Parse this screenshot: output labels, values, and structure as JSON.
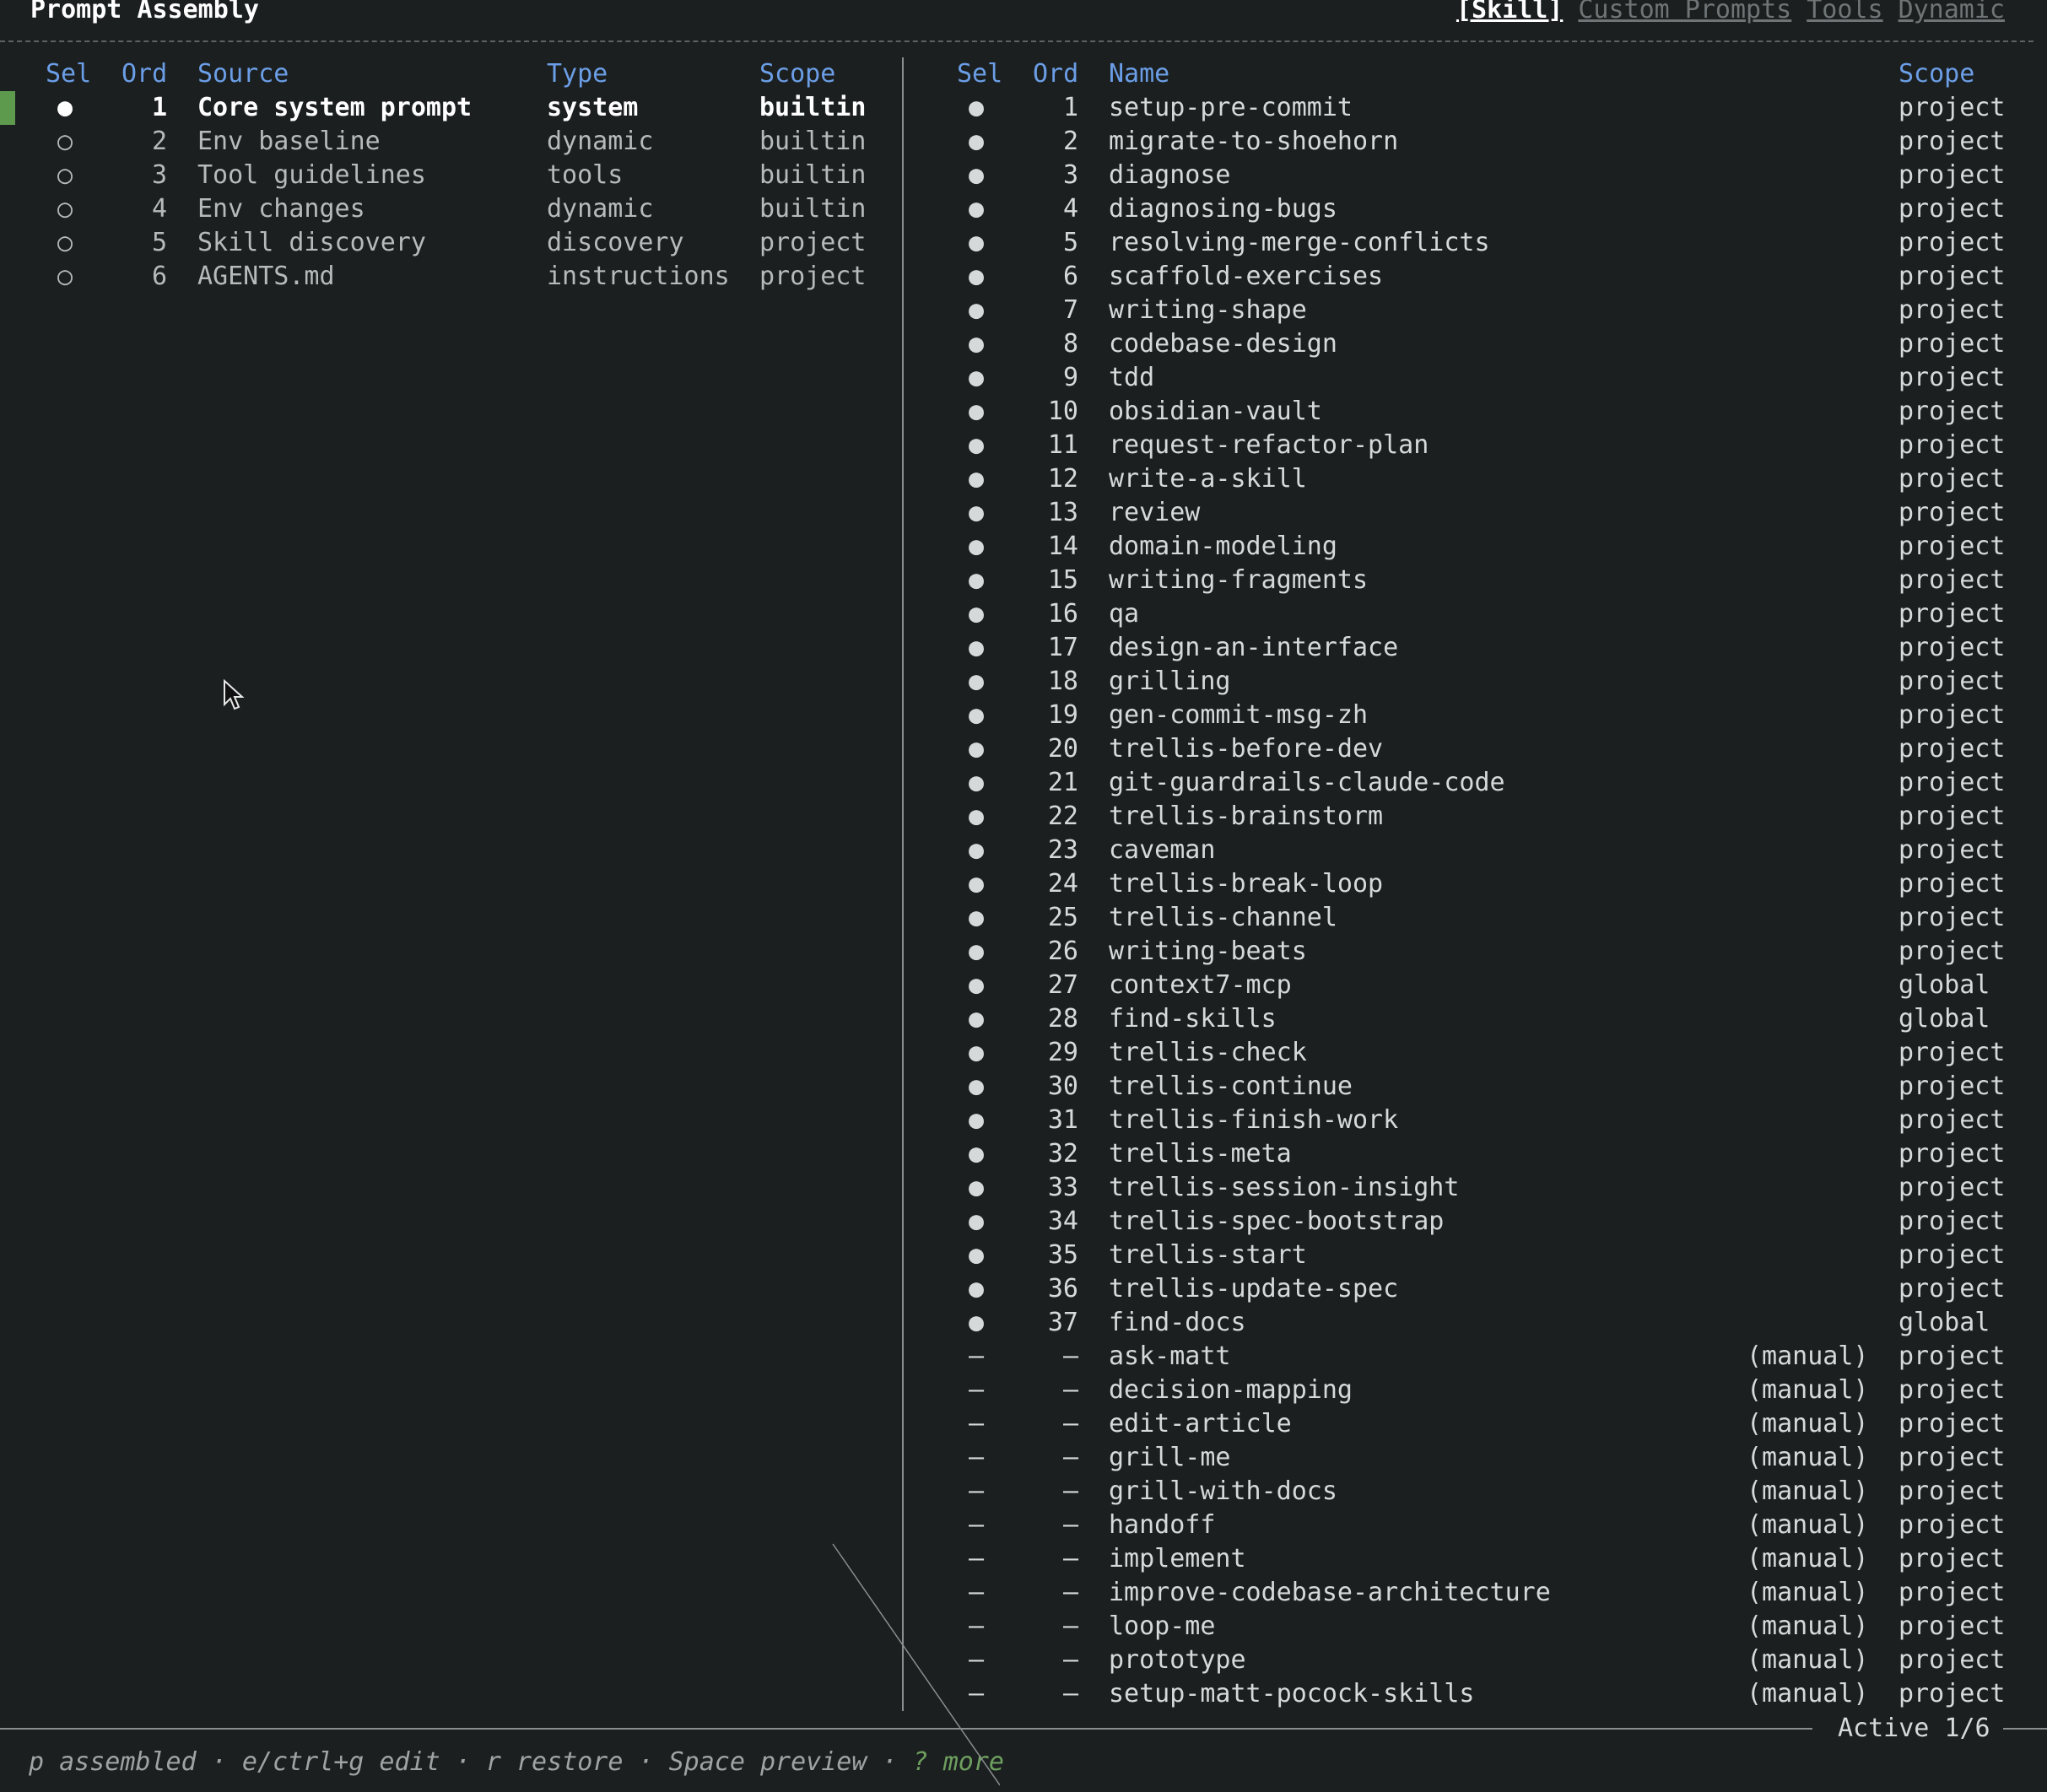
{
  "app": {
    "title": "Prompt Assembly"
  },
  "tabs": [
    {
      "label": "[Skill]",
      "active": true
    },
    {
      "label": "Custom Prompts",
      "active": false
    },
    {
      "label": "Tools",
      "active": false
    },
    {
      "label": "Dynamic",
      "active": false
    }
  ],
  "left_table": {
    "headers": {
      "sel": "Sel",
      "ord": "Ord",
      "source": "Source",
      "type": "Type",
      "scope": "Scope"
    },
    "rows": [
      {
        "sel": "●",
        "ord": "1",
        "source": "Core system prompt",
        "type": "system",
        "scope": "builtin",
        "active": true
      },
      {
        "sel": "○",
        "ord": "2",
        "source": "Env baseline",
        "type": "dynamic",
        "scope": "builtin"
      },
      {
        "sel": "○",
        "ord": "3",
        "source": "Tool guidelines",
        "type": "tools",
        "scope": "builtin"
      },
      {
        "sel": "○",
        "ord": "4",
        "source": "Env changes",
        "type": "dynamic",
        "scope": "builtin"
      },
      {
        "sel": "○",
        "ord": "5",
        "source": "Skill discovery",
        "type": "discovery",
        "scope": "project"
      },
      {
        "sel": "○",
        "ord": "6",
        "source": "AGENTS.md",
        "type": "instructions",
        "scope": "project"
      }
    ]
  },
  "right_table": {
    "headers": {
      "sel": "Sel",
      "ord": "Ord",
      "name": "Name",
      "scope": "Scope"
    },
    "rows": [
      {
        "sel": "●",
        "ord": "1",
        "name": "setup-pre-commit",
        "note": "",
        "scope": "project"
      },
      {
        "sel": "●",
        "ord": "2",
        "name": "migrate-to-shoehorn",
        "note": "",
        "scope": "project"
      },
      {
        "sel": "●",
        "ord": "3",
        "name": "diagnose",
        "note": "",
        "scope": "project"
      },
      {
        "sel": "●",
        "ord": "4",
        "name": "diagnosing-bugs",
        "note": "",
        "scope": "project"
      },
      {
        "sel": "●",
        "ord": "5",
        "name": "resolving-merge-conflicts",
        "note": "",
        "scope": "project"
      },
      {
        "sel": "●",
        "ord": "6",
        "name": "scaffold-exercises",
        "note": "",
        "scope": "project"
      },
      {
        "sel": "●",
        "ord": "7",
        "name": "writing-shape",
        "note": "",
        "scope": "project"
      },
      {
        "sel": "●",
        "ord": "8",
        "name": "codebase-design",
        "note": "",
        "scope": "project"
      },
      {
        "sel": "●",
        "ord": "9",
        "name": "tdd",
        "note": "",
        "scope": "project"
      },
      {
        "sel": "●",
        "ord": "10",
        "name": "obsidian-vault",
        "note": "",
        "scope": "project"
      },
      {
        "sel": "●",
        "ord": "11",
        "name": "request-refactor-plan",
        "note": "",
        "scope": "project"
      },
      {
        "sel": "●",
        "ord": "12",
        "name": "write-a-skill",
        "note": "",
        "scope": "project"
      },
      {
        "sel": "●",
        "ord": "13",
        "name": "review",
        "note": "",
        "scope": "project"
      },
      {
        "sel": "●",
        "ord": "14",
        "name": "domain-modeling",
        "note": "",
        "scope": "project"
      },
      {
        "sel": "●",
        "ord": "15",
        "name": "writing-fragments",
        "note": "",
        "scope": "project"
      },
      {
        "sel": "●",
        "ord": "16",
        "name": "qa",
        "note": "",
        "scope": "project"
      },
      {
        "sel": "●",
        "ord": "17",
        "name": "design-an-interface",
        "note": "",
        "scope": "project"
      },
      {
        "sel": "●",
        "ord": "18",
        "name": "grilling",
        "note": "",
        "scope": "project"
      },
      {
        "sel": "●",
        "ord": "19",
        "name": "gen-commit-msg-zh",
        "note": "",
        "scope": "project"
      },
      {
        "sel": "●",
        "ord": "20",
        "name": "trellis-before-dev",
        "note": "",
        "scope": "project"
      },
      {
        "sel": "●",
        "ord": "21",
        "name": "git-guardrails-claude-code",
        "note": "",
        "scope": "project"
      },
      {
        "sel": "●",
        "ord": "22",
        "name": "trellis-brainstorm",
        "note": "",
        "scope": "project"
      },
      {
        "sel": "●",
        "ord": "23",
        "name": "caveman",
        "note": "",
        "scope": "project"
      },
      {
        "sel": "●",
        "ord": "24",
        "name": "trellis-break-loop",
        "note": "",
        "scope": "project"
      },
      {
        "sel": "●",
        "ord": "25",
        "name": "trellis-channel",
        "note": "",
        "scope": "project"
      },
      {
        "sel": "●",
        "ord": "26",
        "name": "writing-beats",
        "note": "",
        "scope": "project"
      },
      {
        "sel": "●",
        "ord": "27",
        "name": "context7-mcp",
        "note": "",
        "scope": "global"
      },
      {
        "sel": "●",
        "ord": "28",
        "name": "find-skills",
        "note": "",
        "scope": "global"
      },
      {
        "sel": "●",
        "ord": "29",
        "name": "trellis-check",
        "note": "",
        "scope": "project"
      },
      {
        "sel": "●",
        "ord": "30",
        "name": "trellis-continue",
        "note": "",
        "scope": "project"
      },
      {
        "sel": "●",
        "ord": "31",
        "name": "trellis-finish-work",
        "note": "",
        "scope": "project"
      },
      {
        "sel": "●",
        "ord": "32",
        "name": "trellis-meta",
        "note": "",
        "scope": "project"
      },
      {
        "sel": "●",
        "ord": "33",
        "name": "trellis-session-insight",
        "note": "",
        "scope": "project"
      },
      {
        "sel": "●",
        "ord": "34",
        "name": "trellis-spec-bootstrap",
        "note": "",
        "scope": "project"
      },
      {
        "sel": "●",
        "ord": "35",
        "name": "trellis-start",
        "note": "",
        "scope": "project"
      },
      {
        "sel": "●",
        "ord": "36",
        "name": "trellis-update-spec",
        "note": "",
        "scope": "project"
      },
      {
        "sel": "●",
        "ord": "37",
        "name": "find-docs",
        "note": "",
        "scope": "global"
      },
      {
        "sel": "–",
        "ord": "–",
        "name": "ask-matt",
        "note": "(manual)",
        "scope": "project"
      },
      {
        "sel": "–",
        "ord": "–",
        "name": "decision-mapping",
        "note": "(manual)",
        "scope": "project"
      },
      {
        "sel": "–",
        "ord": "–",
        "name": "edit-article",
        "note": "(manual)",
        "scope": "project"
      },
      {
        "sel": "–",
        "ord": "–",
        "name": "grill-me",
        "note": "(manual)",
        "scope": "project"
      },
      {
        "sel": "–",
        "ord": "–",
        "name": "grill-with-docs",
        "note": "(manual)",
        "scope": "project"
      },
      {
        "sel": "–",
        "ord": "–",
        "name": "handoff",
        "note": "(manual)",
        "scope": "project"
      },
      {
        "sel": "–",
        "ord": "–",
        "name": "implement",
        "note": "(manual)",
        "scope": "project"
      },
      {
        "sel": "–",
        "ord": "–",
        "name": "improve-codebase-architecture",
        "note": "(manual)",
        "scope": "project"
      },
      {
        "sel": "–",
        "ord": "–",
        "name": "loop-me",
        "note": "(manual)",
        "scope": "project"
      },
      {
        "sel": "–",
        "ord": "–",
        "name": "prototype",
        "note": "(manual)",
        "scope": "project"
      },
      {
        "sel": "–",
        "ord": "–",
        "name": "setup-matt-pocock-skills",
        "note": "(manual)",
        "scope": "project"
      }
    ]
  },
  "status": {
    "active": "Active 1/6"
  },
  "keyhints": {
    "text": "p assembled · e/ctrl+g edit · r restore · Space preview · ",
    "more": "? more"
  },
  "icons": {
    "cursor": "mouse-pointer-icon"
  },
  "colors": {
    "header": "#6b9ee6",
    "selected_marker": "#5e9a4e",
    "background": "#1b1f20"
  }
}
